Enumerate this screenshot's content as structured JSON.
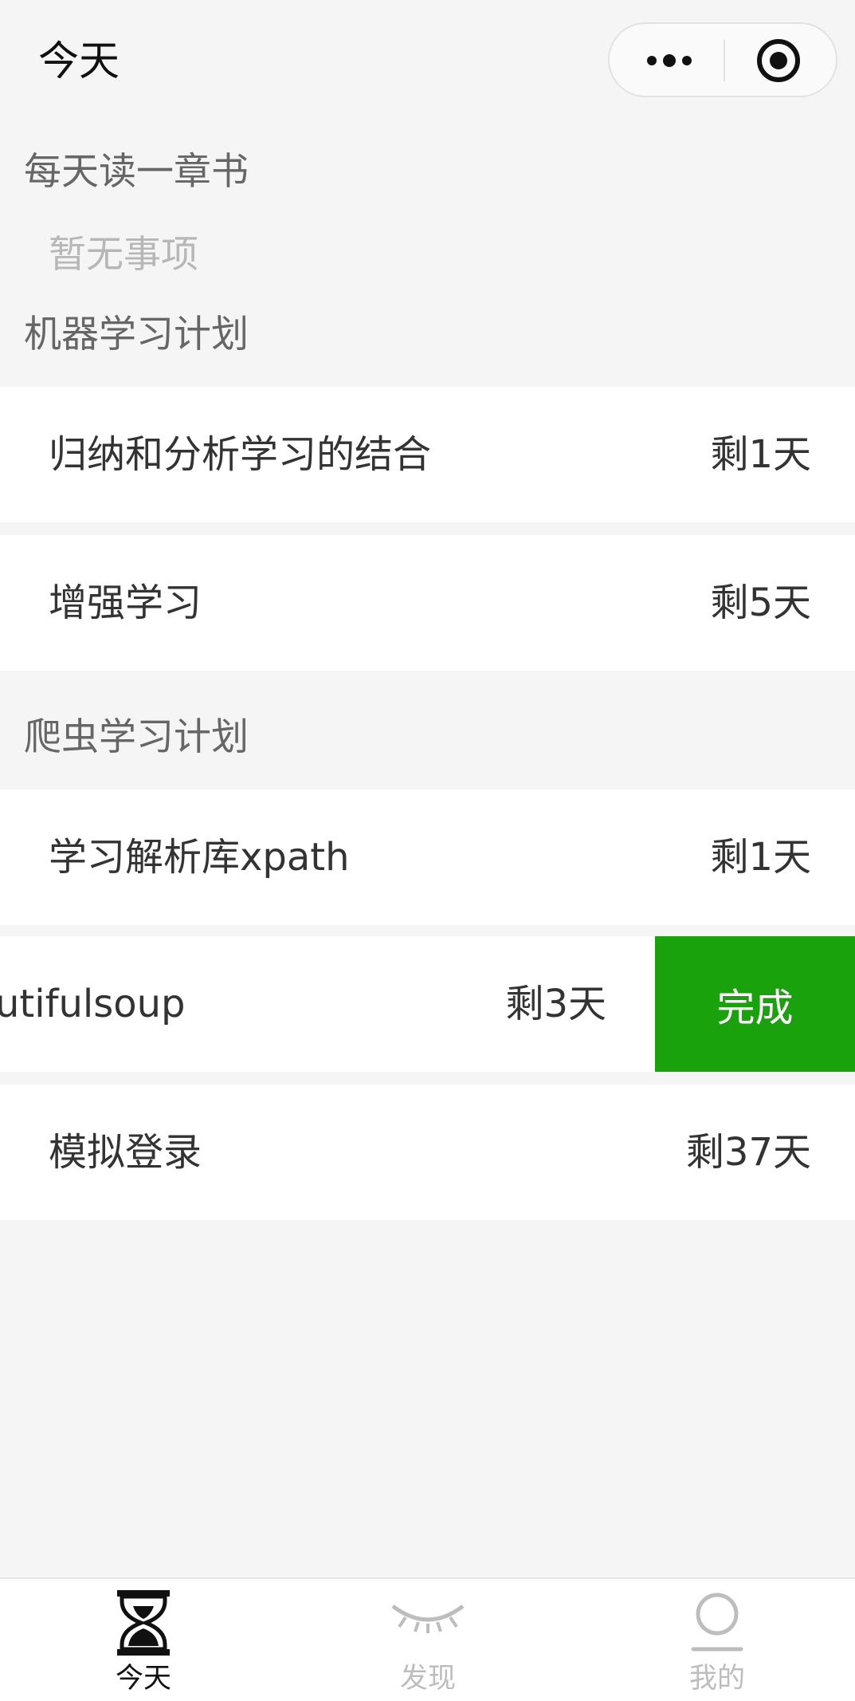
{
  "navbar": {
    "title": "今天",
    "more_icon": "more-dots-icon",
    "close_icon": "target-close-icon"
  },
  "sections": [
    {
      "title": "每天读一章书",
      "empty_text": "暂无事项",
      "items": []
    },
    {
      "title": "机器学习计划",
      "items": [
        {
          "label": "归纳和分析学习的结合",
          "days": "剩1天"
        },
        {
          "label": "增强学习",
          "days": "剩5天"
        }
      ]
    },
    {
      "title": "爬虫学习计划",
      "items": [
        {
          "label": "学习解析库xpath",
          "days": "剩1天"
        },
        {
          "label": "utifulsoup",
          "days": "剩3天",
          "swiped": true,
          "action": "完成"
        },
        {
          "label": "模拟登录",
          "days": "剩37天"
        }
      ]
    }
  ],
  "tabbar": {
    "tabs": [
      {
        "label": "今天",
        "icon": "hourglass-icon",
        "active": true
      },
      {
        "label": "发现",
        "icon": "closed-eye-icon",
        "active": false
      },
      {
        "label": "我的",
        "icon": "person-icon",
        "active": false
      }
    ],
    "active_color": "#111111",
    "inactive_color": "#bdbdbd"
  },
  "colors": {
    "accent_green": "#1aa20c",
    "background": "#f5f5f5"
  }
}
